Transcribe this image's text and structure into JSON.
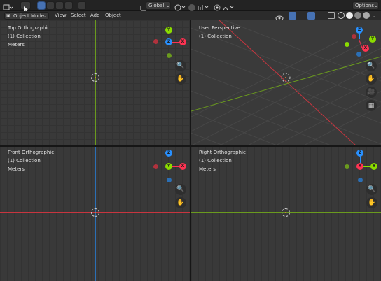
{
  "topbar": {
    "transform_orientation": "Global",
    "options_label": "Options",
    "icons": [
      "editor-type-icon",
      "select-tool-icon",
      "select-box-icon",
      "select-extend-icon",
      "select-subtract-icon",
      "select-intersect-icon",
      "orientation-icon",
      "pivot-icon",
      "snap-icon",
      "snap-target-icon",
      "proportional-edit-icon",
      "falloff-icon"
    ]
  },
  "header": {
    "mode": "Object Mode",
    "menus": [
      "View",
      "Select",
      "Add",
      "Object"
    ],
    "right_icons": [
      "visibility-icon",
      "gizmo-icon",
      "overlay-icon",
      "xray-icon",
      "shading-wireframe-icon",
      "shading-solid-icon",
      "shading-material-icon",
      "shading-rendered-icon"
    ]
  },
  "viewports": [
    {
      "title": "Top Orthographic",
      "collection": "(1) Collection",
      "units": "Meters",
      "gizmo": [
        "Y",
        "Z",
        "X"
      ]
    },
    {
      "title": "User Perspective",
      "collection": "(1) Collection",
      "units": "",
      "gizmo": [
        "Z",
        "Y",
        "X"
      ]
    },
    {
      "title": "Front Orthographic",
      "collection": "(1) Collection",
      "units": "Meters",
      "gizmo": [
        "Z",
        "Y",
        "X"
      ]
    },
    {
      "title": "Right Orthographic",
      "collection": "(1) Collection",
      "units": "Meters",
      "gizmo": [
        "Z",
        "X",
        "Y"
      ]
    }
  ],
  "colors": {
    "x_axis": "#c8353f",
    "y_axis": "#6a9a1e",
    "z_axis": "#2b6fb5",
    "x_dot": "#ff3352",
    "y_dot": "#8bdc00",
    "z_dot": "#2890ff"
  }
}
